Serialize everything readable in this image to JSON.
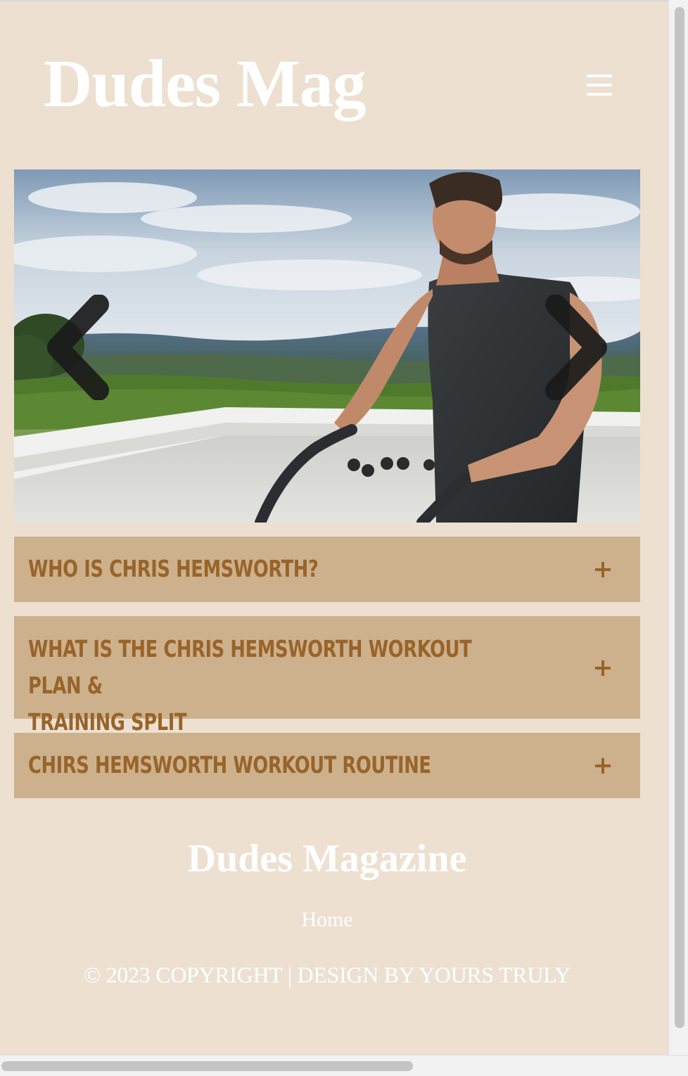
{
  "header": {
    "brand": "Dudes Mag",
    "menu_icon": "hamburger-menu-icon"
  },
  "carousel": {
    "prev_icon": "chevron-left-icon",
    "next_icon": "chevron-right-icon",
    "image_alt": "Chris Hemsworth battle rope workout"
  },
  "accordion": [
    {
      "title": "WHO IS CHRIS HEMSWORTH?",
      "icon": "plus-icon"
    },
    {
      "title_line1": "WHAT IS THE CHRIS HEMSWORTH WORKOUT PLAN &",
      "title_line2": "TRAINING SPLIT",
      "icon": "plus-icon"
    },
    {
      "title": "CHIRS HEMSWORTH WORKOUT ROUTINE",
      "icon": "plus-icon"
    }
  ],
  "footer": {
    "title": "Dudes Magazine",
    "links": [
      "Home"
    ],
    "copyright": "© 2023 COPYRIGHT | DESIGN BY YOURS TRULY"
  },
  "colors": {
    "page_background": "#ede0d1",
    "accordion_background": "#cdb18c",
    "accordion_text": "#98642a",
    "heading_text": "#ffffff"
  }
}
